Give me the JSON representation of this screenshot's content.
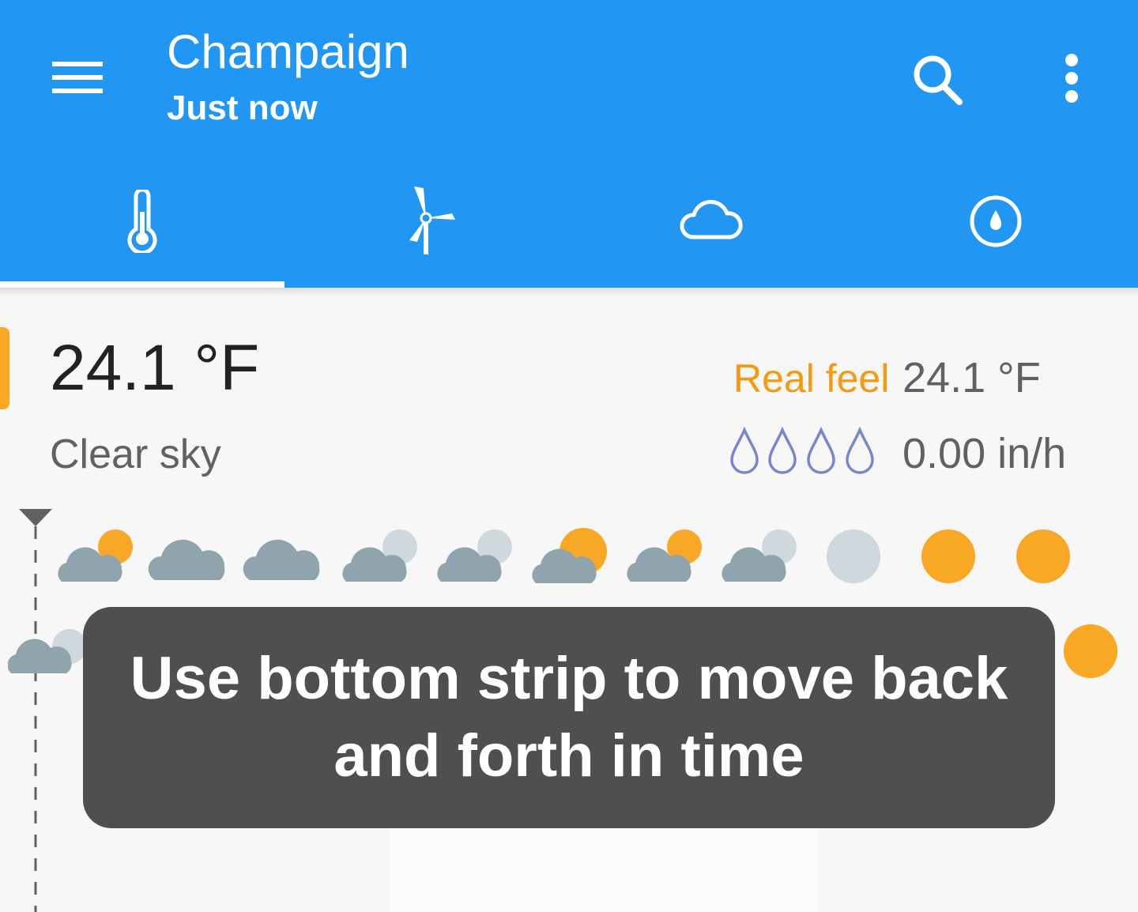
{
  "appbar": {
    "title": "Champaign",
    "subtitle": "Just now",
    "menu_icon": "hamburger-menu-icon",
    "search_icon": "search-icon",
    "more_icon": "more-vert-icon",
    "color": "#2196f3"
  },
  "tabs": [
    {
      "icon": "thermometer-icon",
      "selected": true
    },
    {
      "icon": "wind-turbine-icon",
      "selected": false
    },
    {
      "icon": "cloud-icon",
      "selected": false
    },
    {
      "icon": "compass-drop-icon",
      "selected": false
    }
  ],
  "current": {
    "temperature": "24.1 °F",
    "condition": "Clear sky",
    "real_feel_label": "Real feel",
    "real_feel_value": "24.1 °F",
    "precipitation": "0.00 in/h",
    "accent_color": "#f9a825"
  },
  "hourly_icons": [
    "partly-cloudy-icon",
    "cloud-icon",
    "cloud-icon",
    "cloudy-moon-icon",
    "cloudy-moon-icon",
    "partly-cloudy-icon",
    "partly-cloudy-icon",
    "cloudy-moon-icon",
    "moon-icon",
    "sun-icon",
    "sun-icon"
  ],
  "toast": {
    "text": "Use bottom strip to move back and forth in time"
  }
}
